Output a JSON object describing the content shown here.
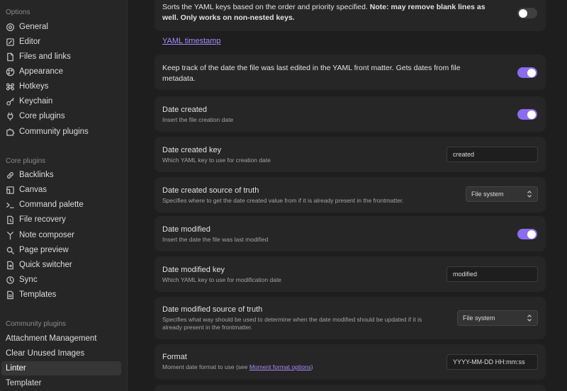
{
  "sidebar": {
    "options_label": "Options",
    "core_label": "Core plugins",
    "community_label": "Community plugins",
    "options": [
      {
        "label": "General",
        "icon": "gear-icon"
      },
      {
        "label": "Editor",
        "icon": "pencil-icon"
      },
      {
        "label": "Files and links",
        "icon": "file-icon"
      },
      {
        "label": "Appearance",
        "icon": "palette-icon"
      },
      {
        "label": "Hotkeys",
        "icon": "command-icon"
      },
      {
        "label": "Keychain",
        "icon": "key-icon"
      },
      {
        "label": "Core plugins",
        "icon": "plug-icon"
      },
      {
        "label": "Community plugins",
        "icon": "puzzle-icon"
      }
    ],
    "core": [
      {
        "label": "Backlinks",
        "icon": "backlink-icon"
      },
      {
        "label": "Canvas",
        "icon": "canvas-icon"
      },
      {
        "label": "Command palette",
        "icon": "terminal-icon"
      },
      {
        "label": "File recovery",
        "icon": "history-icon"
      },
      {
        "label": "Note composer",
        "icon": "merge-icon"
      },
      {
        "label": "Page preview",
        "icon": "preview-icon"
      },
      {
        "label": "Quick switcher",
        "icon": "switcher-icon"
      },
      {
        "label": "Sync",
        "icon": "sync-icon"
      },
      {
        "label": "Templates",
        "icon": "template-icon"
      }
    ],
    "community": [
      {
        "label": "Attachment Management"
      },
      {
        "label": "Clear Unused Images"
      },
      {
        "label": "Linter"
      },
      {
        "label": "Templater"
      }
    ]
  },
  "main": {
    "sort_keys": {
      "text_plain": "Sorts the YAML keys based on the order and priority specified. ",
      "text_bold": "Note: may remove blank lines as well. Only works on non-nested keys.",
      "enabled": false
    },
    "section_link": "YAML timestamp",
    "track_dates": {
      "text": "Keep track of the date the file was last edited in the YAML front matter. Gets dates from file metadata.",
      "enabled": true
    },
    "date_created": {
      "name": "Date created",
      "desc": "Insert the file creation date",
      "enabled": true
    },
    "date_created_key": {
      "name": "Date created key",
      "desc": "Which YAML key to use for creation date",
      "value": "created"
    },
    "date_created_source": {
      "name": "Date created source of truth",
      "desc": "Specifies where to get the date created value from if it is already present in the frontmatter.",
      "selected": "File system"
    },
    "date_modified": {
      "name": "Date modified",
      "desc": "Insert the date the file was last modified",
      "enabled": true
    },
    "date_modified_key": {
      "name": "Date modified key",
      "desc": "Which YAML key to use for modification date",
      "value": "modified"
    },
    "date_modified_source": {
      "name": "Date modified source of truth",
      "desc_line1": "Specifies what way should be used to determine when the date modified should be updated if it is",
      "desc_line2": "already present in the frontmatter.",
      "selected": "File system"
    },
    "format": {
      "name": "Format",
      "desc_prefix": "Moment date format to use (see ",
      "desc_link": "Moment format options",
      "desc_suffix": ")",
      "value": "YYYY-MM-DD HH:mm:ss"
    }
  },
  "colors": {
    "accent": "#8b6cef",
    "link": "#a78bfa",
    "background": "#1e1e1e",
    "card": "#262626"
  }
}
